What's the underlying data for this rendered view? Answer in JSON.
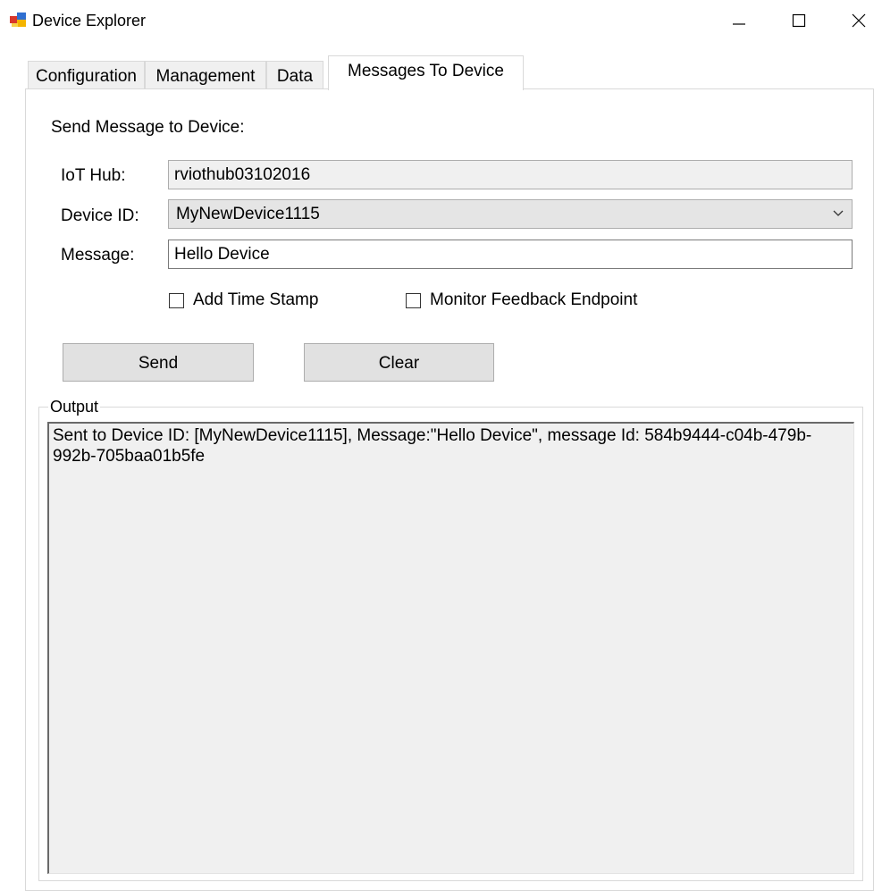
{
  "window": {
    "title": "Device Explorer"
  },
  "tabs": [
    {
      "label": "Configuration",
      "active": false
    },
    {
      "label": "Management",
      "active": false
    },
    {
      "label": "Data",
      "active": false
    },
    {
      "label": "Messages To Device",
      "active": true
    }
  ],
  "send_panel": {
    "heading": "Send Message to Device:",
    "iot_hub": {
      "label": "IoT Hub:",
      "value": "rviothub03102016"
    },
    "device_id": {
      "label": "Device ID:",
      "selected": "MyNewDevice1115"
    },
    "message": {
      "label": "Message:",
      "value": "Hello Device"
    },
    "add_timestamp": {
      "label": "Add Time Stamp",
      "checked": false
    },
    "monitor_feedback": {
      "label": "Monitor Feedback Endpoint",
      "checked": false
    },
    "send_label": "Send",
    "clear_label": "Clear"
  },
  "output": {
    "legend": "Output",
    "text": "Sent to Device ID: [MyNewDevice1115], Message:\"Hello Device\", message Id: 584b9444-c04b-479b-992b-705baa01b5fe"
  },
  "colors": {
    "panel_background": "#ffffff",
    "inactive_tab": "#f0f0f0",
    "button_face": "#e1e1e1",
    "readonly_field": "#f0f0f0",
    "combo_face": "#e5e5e5"
  }
}
